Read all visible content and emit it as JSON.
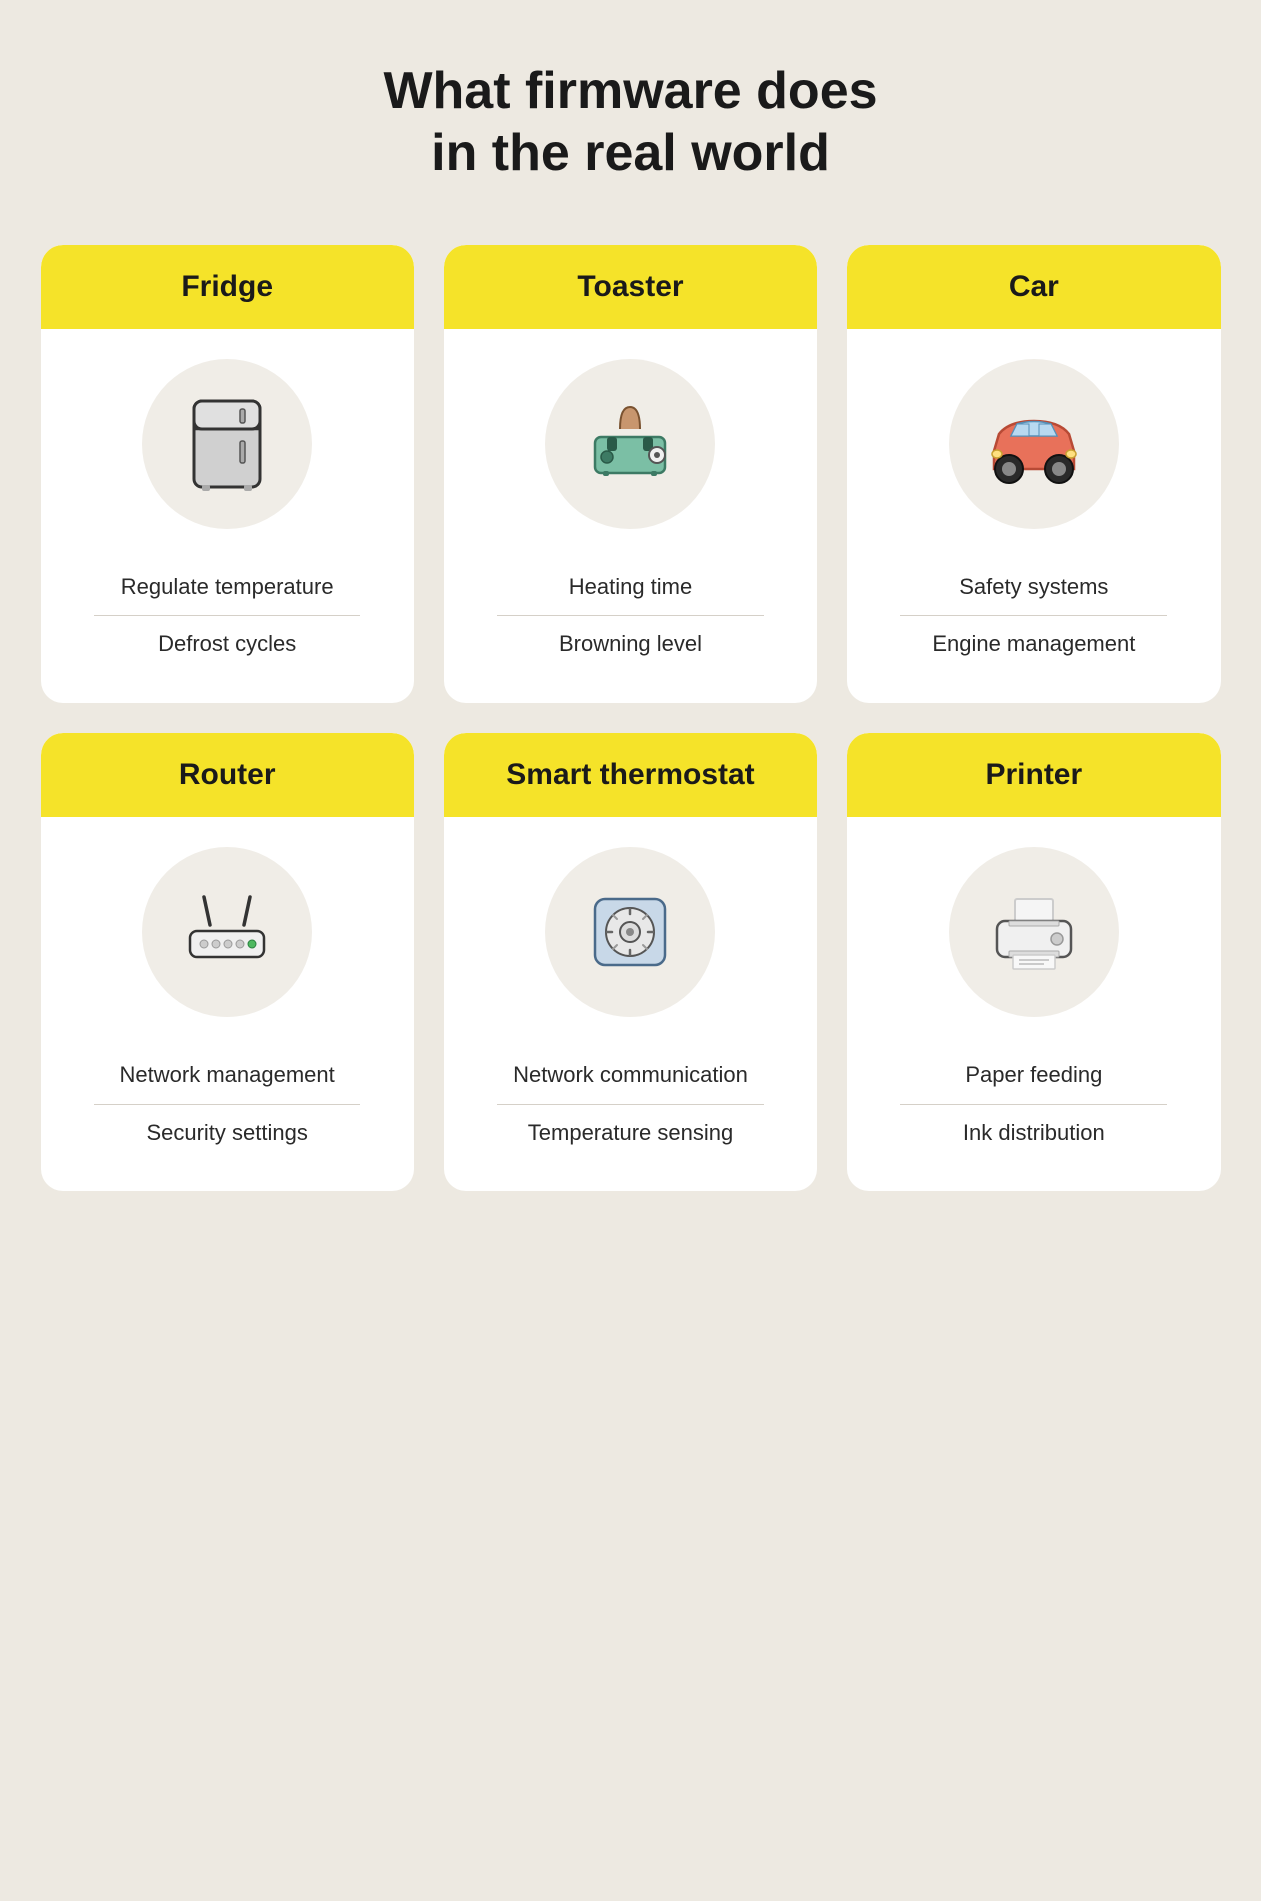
{
  "page": {
    "title_line1": "What firmware does",
    "title_line2": "in the real world"
  },
  "cards": [
    {
      "id": "fridge",
      "title": "Fridge",
      "feature1": "Regulate temperature",
      "feature2": "Defrost cycles"
    },
    {
      "id": "toaster",
      "title": "Toaster",
      "feature1": "Heating time",
      "feature2": "Browning level"
    },
    {
      "id": "car",
      "title": "Car",
      "feature1": "Safety systems",
      "feature2": "Engine management"
    },
    {
      "id": "router",
      "title": "Router",
      "feature1": "Network management",
      "feature2": "Security settings"
    },
    {
      "id": "thermostat",
      "title": "Smart thermostat",
      "feature1": "Network communication",
      "feature2": "Temperature sensing"
    },
    {
      "id": "printer",
      "title": "Printer",
      "feature1": "Paper feeding",
      "feature2": "Ink distribution"
    }
  ]
}
